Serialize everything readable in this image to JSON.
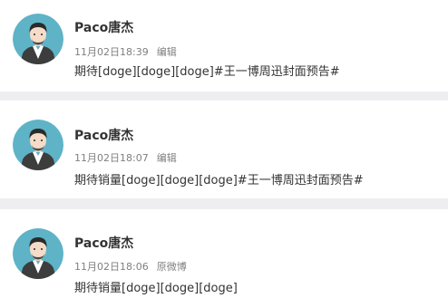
{
  "posts": [
    {
      "author": "Paco唐杰",
      "time": "11月02日18:39",
      "action": "编辑",
      "content": "期待[doge][doge][doge]#王一博周迅封面预告#"
    },
    {
      "author": "Paco唐杰",
      "time": "11月02日18:07",
      "action": "编辑",
      "content": "期待销量[doge][doge][doge]#王一博周迅封面预告#"
    },
    {
      "author": "Paco唐杰",
      "time": "11月02日18:06",
      "action": "原微博",
      "content": "期待销量[doge][doge][doge]"
    }
  ],
  "colors": {
    "background": "#eeeef0",
    "card": "#ffffff",
    "author_text": "#333333",
    "meta_text": "#808080",
    "avatar_bg": "#5fb3c6"
  },
  "icons": {
    "avatar": "user-avatar-illustration"
  }
}
